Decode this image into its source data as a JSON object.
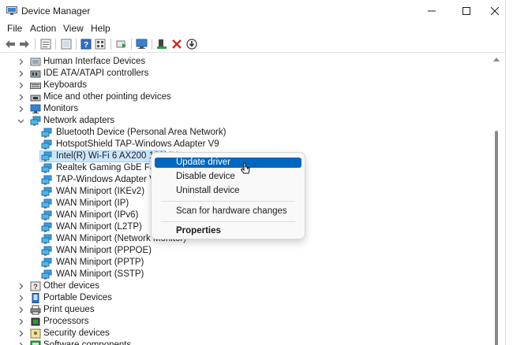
{
  "window": {
    "title": "Device Manager",
    "minimize": "minimize-icon",
    "maximize": "maximize-icon",
    "close": "close-icon"
  },
  "menu": [
    "File",
    "Action",
    "View",
    "Help"
  ],
  "toolbar_icons": [
    "back-arrow-icon",
    "forward-arrow-icon",
    "properties-icon",
    "driver-icon",
    "help-icon",
    "view-icon",
    "scan-hardware-icon",
    "monitor-icon",
    "update-driver-icon",
    "uninstall-icon",
    "disable-icon"
  ],
  "tree": {
    "items": [
      {
        "label": "Human Interface Devices",
        "icon": "hid-icon",
        "level": 0,
        "expanded": false
      },
      {
        "label": "IDE ATA/ATAPI controllers",
        "icon": "ide-controller-icon",
        "level": 0,
        "expanded": false
      },
      {
        "label": "Keyboards",
        "icon": "keyboard-icon",
        "level": 0,
        "expanded": false
      },
      {
        "label": "Mice and other pointing devices",
        "icon": "mouse-icon",
        "level": 0,
        "expanded": false
      },
      {
        "label": "Monitors",
        "icon": "monitor-icon",
        "level": 0,
        "expanded": false
      },
      {
        "label": "Network adapters",
        "icon": "network-adapter-icon",
        "level": 0,
        "expanded": true
      },
      {
        "label": "Bluetooth Device (Personal Area Network)",
        "icon": "network-adapter-icon",
        "level": 1
      },
      {
        "label": "HotspotShield TAP-Windows Adapter V9",
        "icon": "network-adapter-icon",
        "level": 1
      },
      {
        "label": "Intel(R) Wi-Fi 6 AX200 160MHz",
        "icon": "network-adapter-icon",
        "level": 1,
        "selected": true
      },
      {
        "label": "Realtek Gaming GbE Family Controller",
        "icon": "network-adapter-icon",
        "level": 1
      },
      {
        "label": "TAP-Windows Adapter V9",
        "icon": "network-adapter-icon",
        "level": 1
      },
      {
        "label": "WAN Miniport (IKEv2)",
        "icon": "network-adapter-icon",
        "level": 1
      },
      {
        "label": "WAN Miniport (IP)",
        "icon": "network-adapter-icon",
        "level": 1
      },
      {
        "label": "WAN Miniport (IPv6)",
        "icon": "network-adapter-icon",
        "level": 1
      },
      {
        "label": "WAN Miniport (L2TP)",
        "icon": "network-adapter-icon",
        "level": 1
      },
      {
        "label": "WAN Miniport (Network Monitor)",
        "icon": "network-adapter-icon",
        "level": 1
      },
      {
        "label": "WAN Miniport (PPPOE)",
        "icon": "network-adapter-icon",
        "level": 1
      },
      {
        "label": "WAN Miniport (PPTP)",
        "icon": "network-adapter-icon",
        "level": 1
      },
      {
        "label": "WAN Miniport (SSTP)",
        "icon": "network-adapter-icon",
        "level": 1
      },
      {
        "label": "Other devices",
        "icon": "other-devices-icon",
        "level": 0,
        "expanded": false
      },
      {
        "label": "Portable Devices",
        "icon": "portable-device-icon",
        "level": 0,
        "expanded": false
      },
      {
        "label": "Print queues",
        "icon": "printer-icon",
        "level": 0,
        "expanded": false
      },
      {
        "label": "Processors",
        "icon": "processor-icon",
        "level": 0,
        "expanded": false
      },
      {
        "label": "Security devices",
        "icon": "security-device-icon",
        "level": 0,
        "expanded": false
      },
      {
        "label": "Software components",
        "icon": "software-component-icon",
        "level": 0,
        "expanded": false
      }
    ]
  },
  "context_menu": {
    "items": [
      "Update driver",
      "Disable device",
      "Uninstall device",
      "Scan for hardware changes",
      "Properties"
    ],
    "highlighted": "Update driver",
    "bold": "Properties"
  },
  "colors": {
    "selection_bg": "#cce8ff",
    "menu_highlight": "#0067c0",
    "uninstall_red": "#d42a1e",
    "device_blue": "#3a7fd0"
  }
}
